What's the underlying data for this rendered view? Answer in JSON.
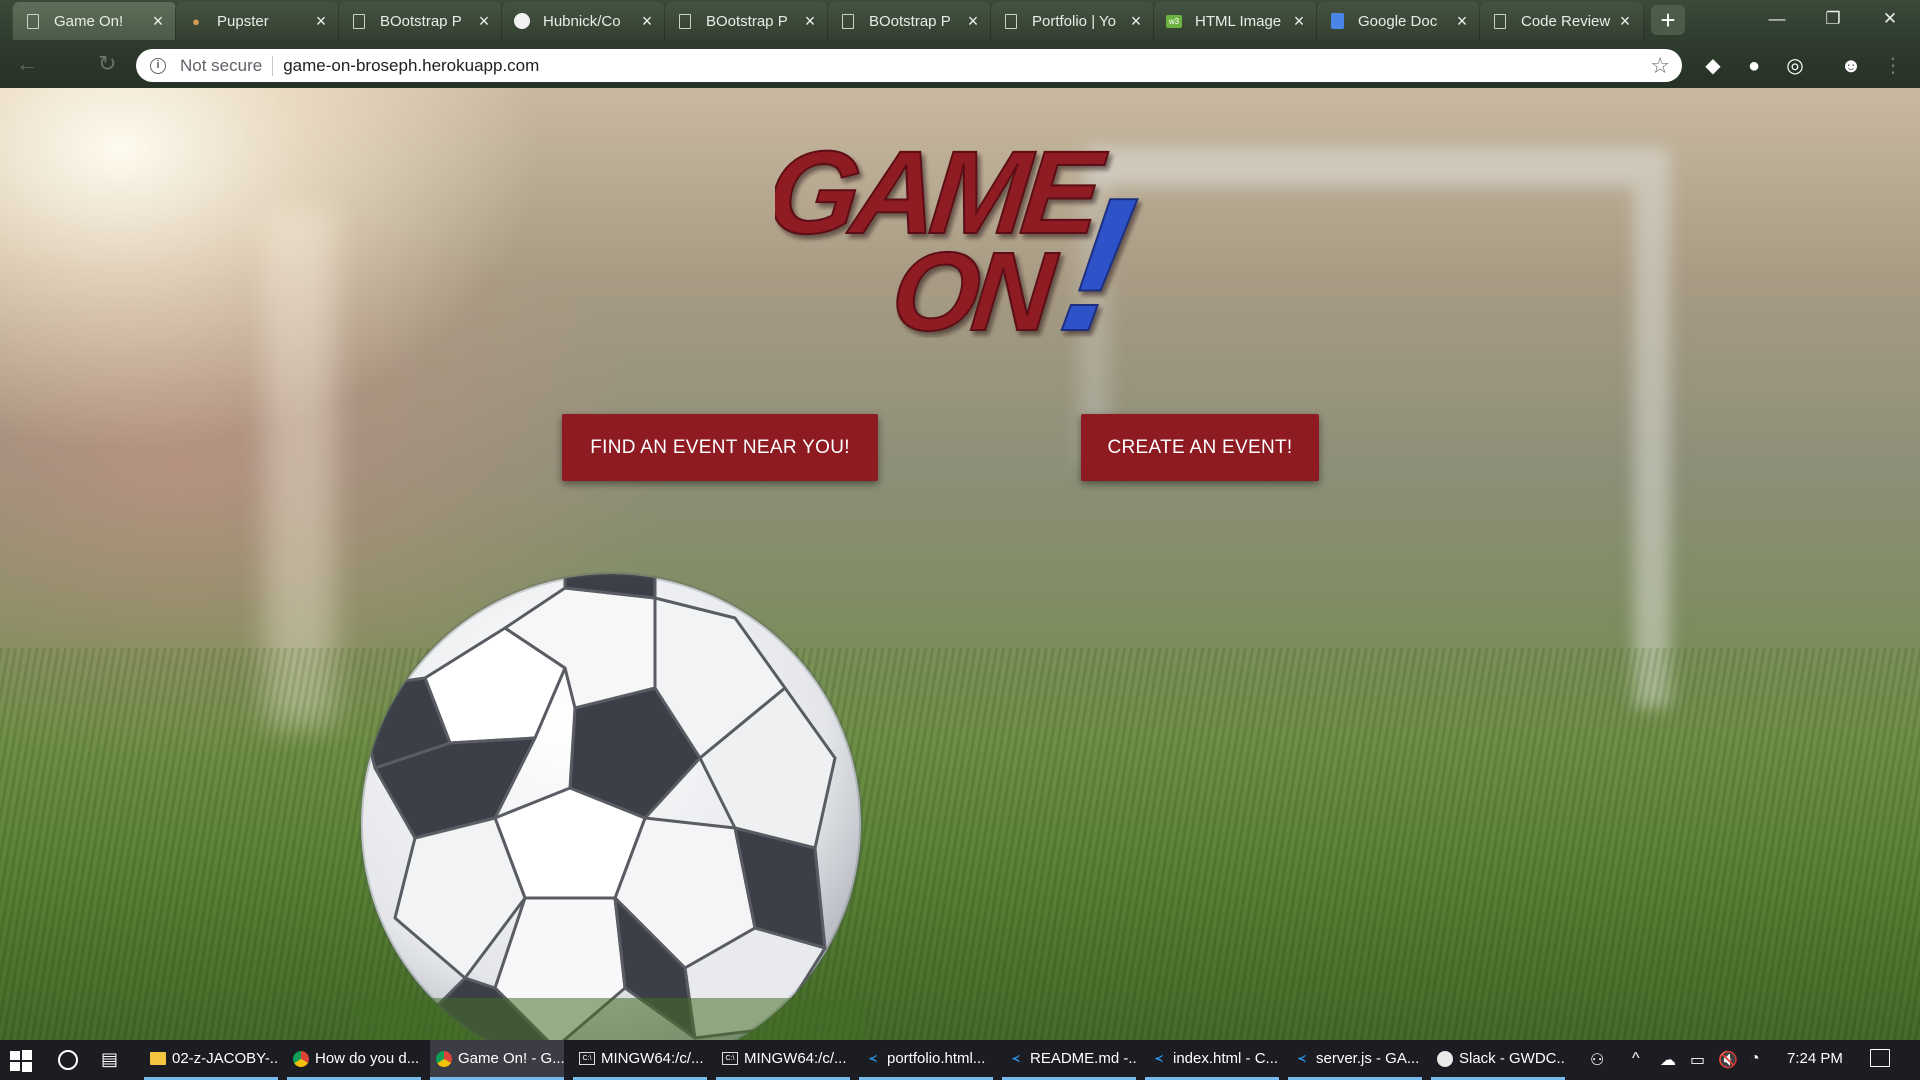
{
  "browser": {
    "tabs": [
      {
        "title": "Game On!",
        "icon": "page-icon",
        "active": true
      },
      {
        "title": "Pupster",
        "icon": "pupster-icon",
        "active": false
      },
      {
        "title": "BOotstrap P",
        "icon": "document-icon",
        "active": false
      },
      {
        "title": "Hubnick/Co",
        "icon": "github-icon",
        "active": false
      },
      {
        "title": "BOotstrap P",
        "icon": "document-icon",
        "active": false
      },
      {
        "title": "BOotstrap P",
        "icon": "document-icon",
        "active": false
      },
      {
        "title": "Portfolio | Yo",
        "icon": "document-icon",
        "active": false
      },
      {
        "title": "HTML Image",
        "icon": "w3schools-icon",
        "active": false
      },
      {
        "title": "Google Doc",
        "icon": "google-docs-icon",
        "active": false
      },
      {
        "title": "Code Review",
        "icon": "document-icon",
        "active": false
      }
    ],
    "security_label": "Not secure",
    "url": "game-on-broseph.herokuapp.com"
  },
  "page": {
    "logo": {
      "line1": "GAME",
      "line2": "ON",
      "mark": "!"
    },
    "buttons": {
      "find_event": "FIND AN EVENT NEAR YOU!",
      "create_event": "CREATE AN EVENT!"
    },
    "colors": {
      "button_bg": "#8e1a22",
      "logo_red": "#8e1a22",
      "logo_blue": "#2f52c8"
    }
  },
  "taskbar": {
    "items": [
      {
        "label": "02-z-JACOBY-...",
        "icon": "folder-icon",
        "active": false
      },
      {
        "label": "How do you d...",
        "icon": "chrome-icon",
        "active": false
      },
      {
        "label": "Game On! - G...",
        "icon": "chrome-icon",
        "active": true
      },
      {
        "label": "MINGW64:/c/...",
        "icon": "terminal-icon",
        "active": false
      },
      {
        "label": "MINGW64:/c/...",
        "icon": "terminal-icon",
        "active": false
      },
      {
        "label": "portfolio.html...",
        "icon": "vscode-icon",
        "active": false
      },
      {
        "label": "README.md -...",
        "icon": "vscode-icon",
        "active": false
      },
      {
        "label": "index.html - C...",
        "icon": "vscode-icon",
        "active": false
      },
      {
        "label": "server.js - GA...",
        "icon": "vscode-icon",
        "active": false
      },
      {
        "label": "Slack - GWDC...",
        "icon": "slack-icon",
        "active": false
      }
    ],
    "clock": "7:24 PM"
  }
}
